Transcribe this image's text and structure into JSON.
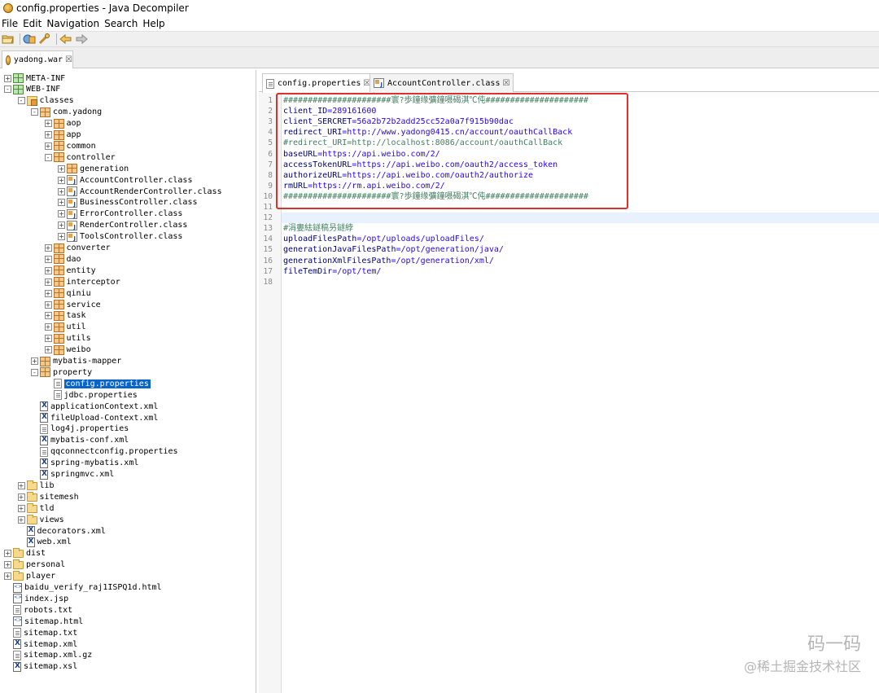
{
  "window": {
    "title": "config.properties - Java Decompiler"
  },
  "menu": [
    "File",
    "Edit",
    "Navigation",
    "Search",
    "Help"
  ],
  "toolbar": {
    "icons": [
      "open-file-icon",
      "open-type-icon",
      "search-icon",
      "back-icon",
      "forward-icon"
    ]
  },
  "outer_tab": {
    "label": "yadong.war",
    "close": "☒"
  },
  "tree": [
    {
      "label": "META-INF",
      "icon": "pkg-green",
      "depth": 0,
      "toggle": "+"
    },
    {
      "label": "WEB-INF",
      "icon": "pkg-green",
      "depth": 0,
      "toggle": "-"
    },
    {
      "label": "classes",
      "icon": "classes",
      "depth": 1,
      "toggle": "-"
    },
    {
      "label": "com.yadong",
      "icon": "pkg",
      "depth": 2,
      "toggle": "-"
    },
    {
      "label": "aop",
      "icon": "pkg",
      "depth": 3,
      "toggle": "+"
    },
    {
      "label": "app",
      "icon": "pkg",
      "depth": 3,
      "toggle": "+"
    },
    {
      "label": "common",
      "icon": "pkg",
      "depth": 3,
      "toggle": "+"
    },
    {
      "label": "controller",
      "icon": "pkg",
      "depth": 3,
      "toggle": "-"
    },
    {
      "label": "generation",
      "icon": "pkg",
      "depth": 4,
      "toggle": "+"
    },
    {
      "label": "AccountController.class",
      "icon": "class",
      "depth": 4,
      "toggle": "+"
    },
    {
      "label": "AccountRenderController.class",
      "icon": "class",
      "depth": 4,
      "toggle": "+"
    },
    {
      "label": "BusinessController.class",
      "icon": "class",
      "depth": 4,
      "toggle": "+"
    },
    {
      "label": "ErrorController.class",
      "icon": "class",
      "depth": 4,
      "toggle": "+"
    },
    {
      "label": "RenderController.class",
      "icon": "class",
      "depth": 4,
      "toggle": "+"
    },
    {
      "label": "ToolsController.class",
      "icon": "class",
      "depth": 4,
      "toggle": "+"
    },
    {
      "label": "converter",
      "icon": "pkg",
      "depth": 3,
      "toggle": "+"
    },
    {
      "label": "dao",
      "icon": "pkg",
      "depth": 3,
      "toggle": "+"
    },
    {
      "label": "entity",
      "icon": "pkg",
      "depth": 3,
      "toggle": "+"
    },
    {
      "label": "interceptor",
      "icon": "pkg",
      "depth": 3,
      "toggle": "+"
    },
    {
      "label": "qiniu",
      "icon": "pkg",
      "depth": 3,
      "toggle": "+"
    },
    {
      "label": "service",
      "icon": "pkg",
      "depth": 3,
      "toggle": "+"
    },
    {
      "label": "task",
      "icon": "pkg",
      "depth": 3,
      "toggle": "+"
    },
    {
      "label": "util",
      "icon": "pkg",
      "depth": 3,
      "toggle": "+"
    },
    {
      "label": "utils",
      "icon": "pkg",
      "depth": 3,
      "toggle": "+"
    },
    {
      "label": "weibo",
      "icon": "pkg",
      "depth": 3,
      "toggle": "+"
    },
    {
      "label": "mybatis-mapper",
      "icon": "pkg",
      "depth": 2,
      "toggle": "+"
    },
    {
      "label": "property",
      "icon": "pkg",
      "depth": 2,
      "toggle": "-"
    },
    {
      "label": "config.properties",
      "icon": "file",
      "depth": 3,
      "toggle": "",
      "selected": true
    },
    {
      "label": "jdbc.properties",
      "icon": "file",
      "depth": 3,
      "toggle": ""
    },
    {
      "label": "applicationContext.xml",
      "icon": "xml",
      "depth": 2,
      "toggle": ""
    },
    {
      "label": "fileUpload-Context.xml",
      "icon": "xml",
      "depth": 2,
      "toggle": ""
    },
    {
      "label": "log4j.properties",
      "icon": "file",
      "depth": 2,
      "toggle": ""
    },
    {
      "label": "mybatis-conf.xml",
      "icon": "xml",
      "depth": 2,
      "toggle": ""
    },
    {
      "label": "qqconnectconfig.properties",
      "icon": "file",
      "depth": 2,
      "toggle": ""
    },
    {
      "label": "spring-mybatis.xml",
      "icon": "xml",
      "depth": 2,
      "toggle": ""
    },
    {
      "label": "springmvc.xml",
      "icon": "xml",
      "depth": 2,
      "toggle": ""
    },
    {
      "label": "lib",
      "icon": "folder",
      "depth": 1,
      "toggle": "+"
    },
    {
      "label": "sitemesh",
      "icon": "folder",
      "depth": 1,
      "toggle": "+"
    },
    {
      "label": "tld",
      "icon": "folder",
      "depth": 1,
      "toggle": "+"
    },
    {
      "label": "views",
      "icon": "folder",
      "depth": 1,
      "toggle": "+"
    },
    {
      "label": "decorators.xml",
      "icon": "xml",
      "depth": 1,
      "toggle": ""
    },
    {
      "label": "web.xml",
      "icon": "xml",
      "depth": 1,
      "toggle": ""
    },
    {
      "label": "dist",
      "icon": "folder",
      "depth": 0,
      "toggle": "+"
    },
    {
      "label": "personal",
      "icon": "folder",
      "depth": 0,
      "toggle": "+"
    },
    {
      "label": "player",
      "icon": "folder",
      "depth": 0,
      "toggle": "+"
    },
    {
      "label": "baidu_verify_raj1ISPQ1d.html",
      "icon": "html",
      "depth": 0,
      "toggle": ""
    },
    {
      "label": "index.jsp",
      "icon": "html",
      "depth": 0,
      "toggle": ""
    },
    {
      "label": "robots.txt",
      "icon": "file",
      "depth": 0,
      "toggle": ""
    },
    {
      "label": "sitemap.html",
      "icon": "html",
      "depth": 0,
      "toggle": ""
    },
    {
      "label": "sitemap.txt",
      "icon": "file",
      "depth": 0,
      "toggle": ""
    },
    {
      "label": "sitemap.xml",
      "icon": "xml",
      "depth": 0,
      "toggle": ""
    },
    {
      "label": "sitemap.xml.gz",
      "icon": "file",
      "depth": 0,
      "toggle": ""
    },
    {
      "label": "sitemap.xsl",
      "icon": "xml",
      "depth": 0,
      "toggle": ""
    }
  ],
  "editor": {
    "tabs": [
      {
        "label": "config.properties",
        "active": true,
        "close": "☒"
      },
      {
        "label": "AccountController.class",
        "active": false,
        "close": "☒"
      }
    ],
    "lines": [
      {
        "n": "1",
        "parts": [
          {
            "t": "######################寰?歩鐘缘彍鐘嗫碣淇℃伅#####################",
            "s": "c"
          }
        ]
      },
      {
        "n": "2",
        "parts": [
          {
            "t": "client_ID",
            "s": "k"
          },
          {
            "t": "=289161600",
            "s": "v"
          }
        ]
      },
      {
        "n": "3",
        "parts": [
          {
            "t": "client_SERCRET",
            "s": "k"
          },
          {
            "t": "=56a2b72b2add25cc52a0a7f915b90dac",
            "s": "v"
          }
        ]
      },
      {
        "n": "4",
        "parts": [
          {
            "t": "redirect_URI",
            "s": "k"
          },
          {
            "t": "=http://www.yadong0415.cn/account/oauthCallBack",
            "s": "v"
          }
        ]
      },
      {
        "n": "5",
        "parts": [
          {
            "t": "#redirect_URI=http://localhost:8086/account/oauthCallBack",
            "s": "c"
          }
        ]
      },
      {
        "n": "6",
        "parts": [
          {
            "t": "baseURL",
            "s": "k"
          },
          {
            "t": "=https://api.weibo.com/2/",
            "s": "v"
          }
        ]
      },
      {
        "n": "7",
        "parts": [
          {
            "t": "accessTokenURL",
            "s": "k"
          },
          {
            "t": "=https://api.weibo.com/oauth2/access_token",
            "s": "v"
          }
        ]
      },
      {
        "n": "8",
        "parts": [
          {
            "t": "authorizeURL",
            "s": "k"
          },
          {
            "t": "=https://api.weibo.com/oauth2/authorize",
            "s": "v"
          }
        ]
      },
      {
        "n": "9",
        "parts": [
          {
            "t": "rmURL",
            "s": "k"
          },
          {
            "t": "=https://rm.api.weibo.com/2/",
            "s": "v"
          }
        ]
      },
      {
        "n": "10",
        "parts": [
          {
            "t": "######################寰?歩鐘缘彍鐘嗫碣淇℃伅#####################",
            "s": "c"
          }
        ]
      },
      {
        "n": "11",
        "parts": []
      },
      {
        "n": "12",
        "parts": [],
        "current": true
      },
      {
        "n": "13",
        "parts": [
          {
            "t": "#涓婁紶鐩稿叧鐩綍",
            "s": "c"
          }
        ]
      },
      {
        "n": "14",
        "parts": [
          {
            "t": "uploadFilesPath",
            "s": "k"
          },
          {
            "t": "=/opt/uploads/uploadFiles/",
            "s": "v"
          }
        ]
      },
      {
        "n": "15",
        "parts": [
          {
            "t": "generationJavaFilesPath",
            "s": "k"
          },
          {
            "t": "=/opt/generation/java/",
            "s": "v"
          }
        ]
      },
      {
        "n": "16",
        "parts": [
          {
            "t": "generationXmlFilesPath",
            "s": "k"
          },
          {
            "t": "=/opt/generation/xml/",
            "s": "v"
          }
        ]
      },
      {
        "n": "17",
        "parts": [
          {
            "t": "fileTemDir",
            "s": "k"
          },
          {
            "t": "=/opt/tem/",
            "s": "v"
          }
        ]
      },
      {
        "n": "18",
        "parts": []
      }
    ]
  },
  "watermark": {
    "brand": "码一码",
    "sub": "@稀土掘金技术社区"
  },
  "colors": {
    "key": "#000080",
    "value": "#2a00ff",
    "comment": "#3f7f5f",
    "highlight": "#e0302c",
    "selection": "#0a64c8"
  }
}
